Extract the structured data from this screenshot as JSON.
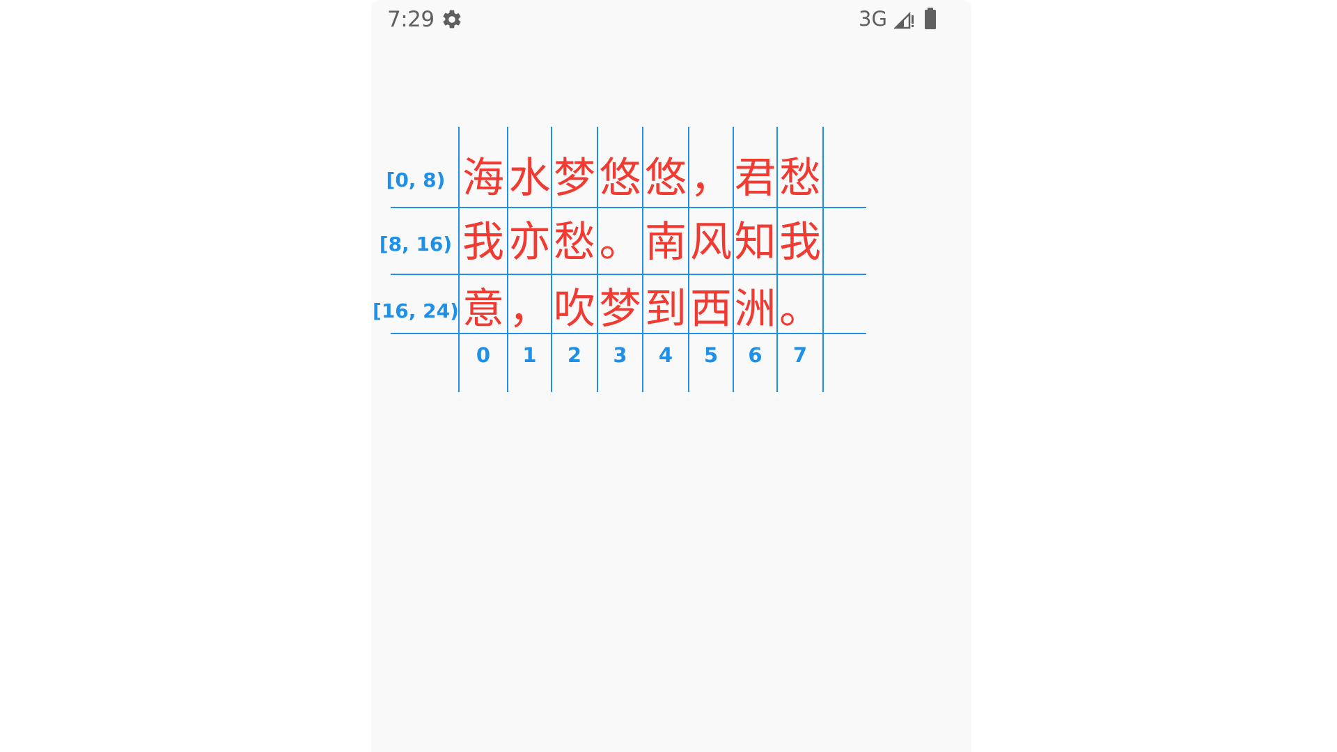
{
  "status_bar": {
    "time": "7:29",
    "network": "3G",
    "icons": [
      "gear-icon",
      "signal-icon",
      "battery-icon"
    ]
  },
  "colors": {
    "text": "#ef3b32",
    "grid": "#1e90e8",
    "background": "#f9f9f9"
  },
  "text_grid": {
    "rows": [
      {
        "label": "[0, 8)",
        "chars": [
          "海",
          "水",
          "梦",
          "悠",
          "悠",
          "，",
          "君",
          "愁"
        ]
      },
      {
        "label": "[8, 16)",
        "chars": [
          "我",
          "亦",
          "愁",
          "。",
          "南",
          "风",
          "知",
          "我"
        ]
      },
      {
        "label": "[16, 24)",
        "chars": [
          "意",
          "，",
          "吹",
          "梦",
          "到",
          "西",
          "洲",
          "。"
        ]
      }
    ],
    "column_indices": [
      "0",
      "1",
      "2",
      "3",
      "4",
      "5",
      "6",
      "7"
    ]
  }
}
